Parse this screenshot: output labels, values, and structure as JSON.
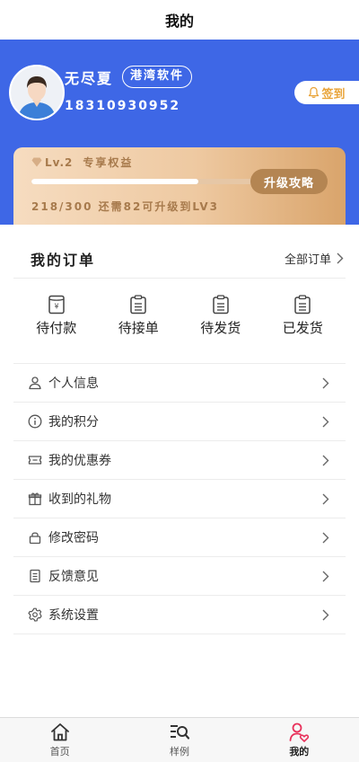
{
  "nav": {
    "title": "我的"
  },
  "user": {
    "name": "无尽夏",
    "tag": "港湾软件",
    "phone": "18310930952"
  },
  "signin": {
    "label": "签到"
  },
  "vip": {
    "level": "Lv.2",
    "title": "专享权益",
    "upgrade_label": "升级攻略",
    "progress_text": "218/300 还需82可升级到LV3",
    "progress_current": 218,
    "progress_total": 300
  },
  "orders": {
    "title": "我的订单",
    "all_label": "全部订单",
    "items": [
      {
        "label": "待付款",
        "icon": "payment-icon"
      },
      {
        "label": "待接单",
        "icon": "clipboard-icon"
      },
      {
        "label": "待发货",
        "icon": "clipboard-icon"
      },
      {
        "label": "已发货",
        "icon": "clipboard-icon"
      }
    ]
  },
  "menu": [
    {
      "label": "个人信息",
      "icon": "user-icon"
    },
    {
      "label": "我的积分",
      "icon": "info-icon"
    },
    {
      "label": "我的优惠券",
      "icon": "ticket-icon"
    },
    {
      "label": "收到的礼物",
      "icon": "gift-icon"
    },
    {
      "label": "修改密码",
      "icon": "lock-icon"
    },
    {
      "label": "反馈意见",
      "icon": "feedback-icon"
    },
    {
      "label": "系统设置",
      "icon": "gear-icon"
    }
  ],
  "tabbar": [
    {
      "label": "首页",
      "icon": "home-icon"
    },
    {
      "label": "样例",
      "icon": "search-list-icon"
    },
    {
      "label": "我的",
      "icon": "profile-icon",
      "active": true
    }
  ],
  "colors": {
    "header_bg": "#3e67e6",
    "vip_text": "#a77a4c",
    "signin_text": "#e9a43a",
    "active_tab": "#e8315b"
  }
}
